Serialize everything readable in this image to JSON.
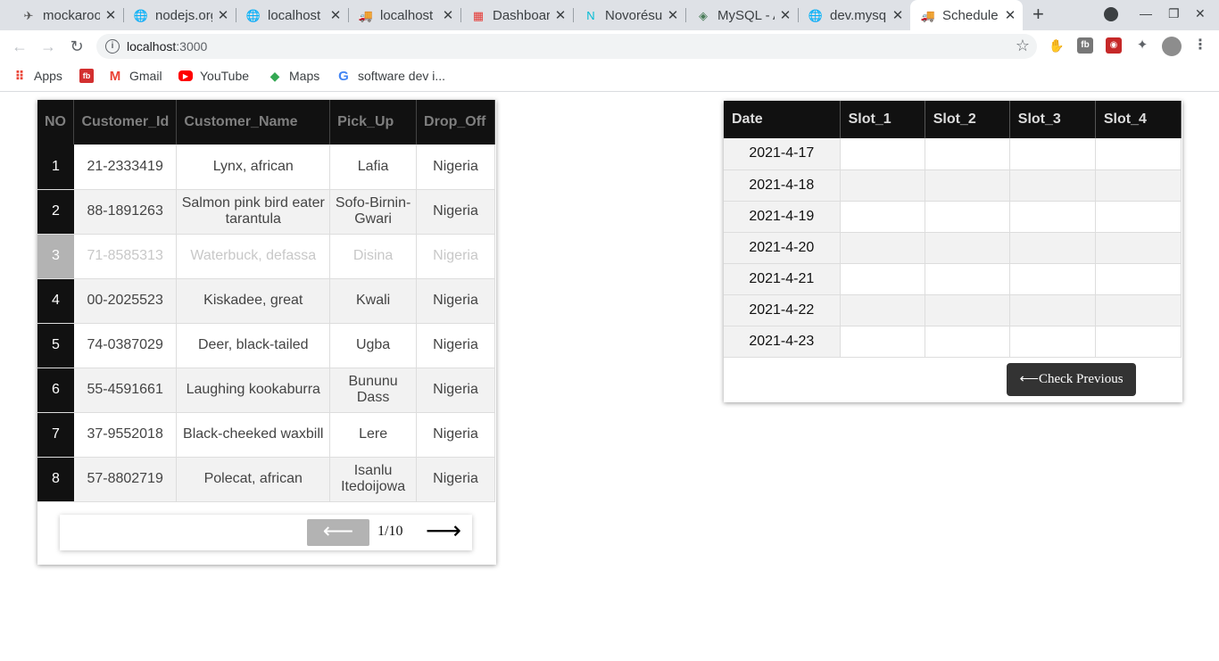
{
  "browser": {
    "tabs": [
      {
        "title": "mockaroo",
        "icon": "mockaroo-icon"
      },
      {
        "title": "nodejs.org",
        "icon": "globe-icon"
      },
      {
        "title": "localhost",
        "icon": "globe-icon"
      },
      {
        "title": "localhost",
        "icon": "truck-icon"
      },
      {
        "title": "Dashboard",
        "icon": "dashboard-icon"
      },
      {
        "title": "Novorésume",
        "icon": "novoresume-icon"
      },
      {
        "title": "MySQL - A",
        "icon": "mysql-icon"
      },
      {
        "title": "dev.mysql",
        "icon": "globe-icon"
      },
      {
        "title": "Schedule",
        "icon": "truck-icon",
        "active": true
      }
    ],
    "url_host": "localhost",
    "url_port": ":3000",
    "bookmarks": [
      {
        "label": "Apps",
        "icon": "apps-grid-icon"
      },
      {
        "label": "",
        "icon": "youtube-red-square-icon"
      },
      {
        "label": "Gmail",
        "icon": "gmail-icon"
      },
      {
        "label": "YouTube",
        "icon": "youtube-icon"
      },
      {
        "label": "Maps",
        "icon": "maps-icon"
      },
      {
        "label": "software dev i...",
        "icon": "google-icon"
      }
    ]
  },
  "customers": {
    "headers": [
      "NO",
      "Customer_Id",
      "Customer_Name",
      "Pick_Up",
      "Drop_Off"
    ],
    "rows": [
      {
        "no": "1",
        "id": "21-2333419",
        "name": "Lynx, african",
        "pickup": "Lafia",
        "dropoff": "Nigeria"
      },
      {
        "no": "2",
        "id": "88-1891263",
        "name": "Salmon pink bird eater tarantula",
        "pickup": "Sofo-Birnin-Gwari",
        "dropoff": "Nigeria"
      },
      {
        "no": "3",
        "id": "71-8585313",
        "name": "Waterbuck, defassa",
        "pickup": "Disina",
        "dropoff": "Nigeria"
      },
      {
        "no": "4",
        "id": "00-2025523",
        "name": "Kiskadee, great",
        "pickup": "Kwali",
        "dropoff": "Nigeria"
      },
      {
        "no": "5",
        "id": "74-0387029",
        "name": "Deer, black-tailed",
        "pickup": "Ugba",
        "dropoff": "Nigeria"
      },
      {
        "no": "6",
        "id": "55-4591661",
        "name": "Laughing kookaburra",
        "pickup": "Bununu Dass",
        "dropoff": "Nigeria"
      },
      {
        "no": "7",
        "id": "37-9552018",
        "name": "Black-cheeked waxbill",
        "pickup": "Lere",
        "dropoff": "Nigeria"
      },
      {
        "no": "8",
        "id": "57-8802719",
        "name": "Polecat, african",
        "pickup": "Isanlu Itedoijowa",
        "dropoff": "Nigeria"
      }
    ],
    "pagination": {
      "prev": "⟵",
      "page": "1/10",
      "next": "⟶"
    }
  },
  "schedule": {
    "headers": [
      "Date",
      "Slot_1",
      "Slot_2",
      "Slot_3",
      "Slot_4"
    ],
    "dates": [
      "2021-4-17",
      "2021-4-18",
      "2021-4-19",
      "2021-4-20",
      "2021-4-21",
      "2021-4-22",
      "2021-4-23"
    ],
    "check_previous": "⟵Check Previous"
  }
}
